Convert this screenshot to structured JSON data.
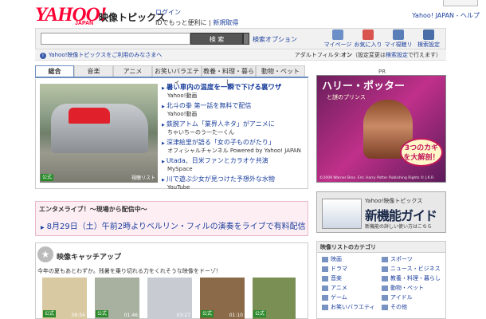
{
  "header": {
    "logo": "YAHOO!",
    "logo_sub": "JAPAN",
    "site_name": "映像トピックス",
    "login": "ログイン",
    "login_sub": "IDでもっと便利に",
    "register": "新規取得",
    "help_links": "Yahoo! JAPAN - ヘルプ"
  },
  "search": {
    "input_value": "",
    "button": "検 索",
    "options": "検索オプション"
  },
  "tools": [
    {
      "label": "マイページ",
      "icon": "mypage-icon",
      "color": "#6c8fc7"
    },
    {
      "label": "お気に入り",
      "icon": "favorites-icon",
      "color": "#d9534f"
    },
    {
      "label": "マイ視聴リスト",
      "icon": "playlist-icon",
      "color": "#5a7fb8"
    },
    {
      "label": "検索設定",
      "icon": "search-settings-icon",
      "color": "#4a6fa8"
    }
  ],
  "notice": {
    "left": "Yahoo!映像トピックスをご利用のみなさまへ",
    "right_prefix": "アダルトフィルタ:",
    "right_status": "オン",
    "right_mid": "（設定変更は",
    "right_link": "検索設定",
    "right_suffix": "で行えます）"
  },
  "tabs": [
    "総合",
    "音楽",
    "アニメ",
    "お笑いバラエティ",
    "教養・料理・暮らし",
    "動物・ペット"
  ],
  "feature": {
    "badge": "公式",
    "list_label": "視聴リスト",
    "items": [
      {
        "title": "暑い車内の温度を一瞬で下げる裏ワザ",
        "source": "Yahoo!動画"
      },
      {
        "title": "北斗の拳 第一話を無料で配信",
        "source": "Yahoo!動画"
      },
      {
        "title": "鉄腕アトム「業界人ネタ」がアニメに",
        "source": "ちゃいちーのう一た一くん"
      },
      {
        "title": "深津絵里が語る「女の子ものがたり」",
        "source": "オフィシャルチャンネル Powered by Yahoo! JAPAN"
      },
      {
        "title": "Utada、日米ファンとカラオケ共演",
        "source": "MySpace"
      },
      {
        "title": "川で遊ぶ少女が見つけた予想外な水物",
        "source": "YouTube"
      }
    ]
  },
  "live": {
    "heading": "エンタメライブ！～現場から配信中～",
    "detail": "8月29日（土）午前2時よりベルリン・フィルの演奏をライブで有料配信"
  },
  "catchup": {
    "heading": "映像キャッチアップ",
    "desc": "今年の夏もあとわずか。残暑を乗り切れる力をくれそうな映像をドーゾ！",
    "thumbs": [
      {
        "badge": "公式",
        "duration": "06:54",
        "color": "#d9c9a2"
      },
      {
        "badge": "公式",
        "duration": "01:46",
        "color": "#a8b0a0"
      },
      {
        "badge": "",
        "duration": "03:27",
        "color": "#c8ccd2"
      },
      {
        "badge": "公式",
        "duration": "01:10",
        "color": "#8a6a48"
      },
      {
        "badge": "公式",
        "duration": "",
        "color": "#7a8f54"
      }
    ]
  },
  "ad": {
    "pr": "PR",
    "title": "ハリー・ポッター",
    "subtitle": "と謎のプリンス",
    "bubble": "3つのカギを大解剖！",
    "copyright": "©2009 Warner Bros. Ent. Harry Potter Publishing Rights © J.K.R."
  },
  "banner": {
    "line1": "Yahoo!映像トピックス",
    "line2": "新機能ガイド",
    "line3": "新機能の詳しい使い方はこちら"
  },
  "categories": {
    "heading": "映像リストのカテゴリ",
    "items": [
      "映画",
      "スポーツ",
      "ドラマ",
      "ニュース・ビジネス",
      "音楽",
      "教養・料理・暮らし",
      "アニメ",
      "動物・ペット",
      "ゲーム",
      "アイドル",
      "お笑いバラエティ",
      "その他"
    ]
  }
}
